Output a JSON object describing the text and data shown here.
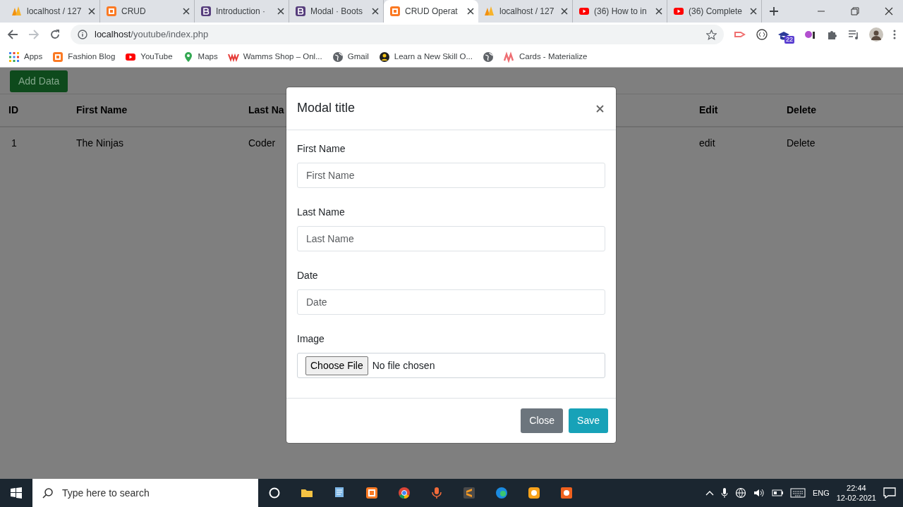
{
  "browser": {
    "tabs": [
      {
        "title": "localhost / 127",
        "selected": false
      },
      {
        "title": "CRUD",
        "selected": false
      },
      {
        "title": "Introduction ·",
        "selected": false
      },
      {
        "title": "Modal · Boots",
        "selected": false
      },
      {
        "title": "CRUD Operat",
        "selected": true
      },
      {
        "title": "localhost / 127",
        "selected": false
      },
      {
        "title": "(36) How to in",
        "selected": false
      },
      {
        "title": "(36) Complete",
        "selected": false
      }
    ],
    "address": {
      "host": "localhost",
      "path": "/youtube/index.php"
    },
    "extension_badge": "22",
    "bookmarks": [
      {
        "label": "Apps"
      },
      {
        "label": "Fashion Blog"
      },
      {
        "label": "YouTube"
      },
      {
        "label": "Maps"
      },
      {
        "label": "Wamms Shop – Onl..."
      },
      {
        "label": "Gmail"
      },
      {
        "label": "Learn a New Skill O..."
      },
      {
        "label": "Cards - Materialize"
      }
    ]
  },
  "page": {
    "add_button": "Add Data",
    "table": {
      "columns": [
        "ID",
        "First Name",
        "Last Na",
        "Edit",
        "Delete"
      ],
      "rows": [
        [
          "1",
          "The Ninjas",
          "Coder",
          "edit",
          "Delete"
        ]
      ]
    }
  },
  "modal": {
    "title": "Modal title",
    "fields": [
      {
        "label": "First Name",
        "placeholder": "First Name"
      },
      {
        "label": "Last Name",
        "placeholder": "Last Name"
      },
      {
        "label": "Date",
        "placeholder": "Date"
      }
    ],
    "file": {
      "label": "Image",
      "button": "Choose File",
      "status": "No file chosen"
    },
    "buttons": [
      {
        "label": "Close",
        "kind": "secondary"
      },
      {
        "label": "Save",
        "kind": "primary"
      }
    ]
  },
  "taskbar": {
    "search_placeholder": "Type here to search",
    "language": "ENG",
    "time": "22:44",
    "date": "12-02-2021"
  }
}
